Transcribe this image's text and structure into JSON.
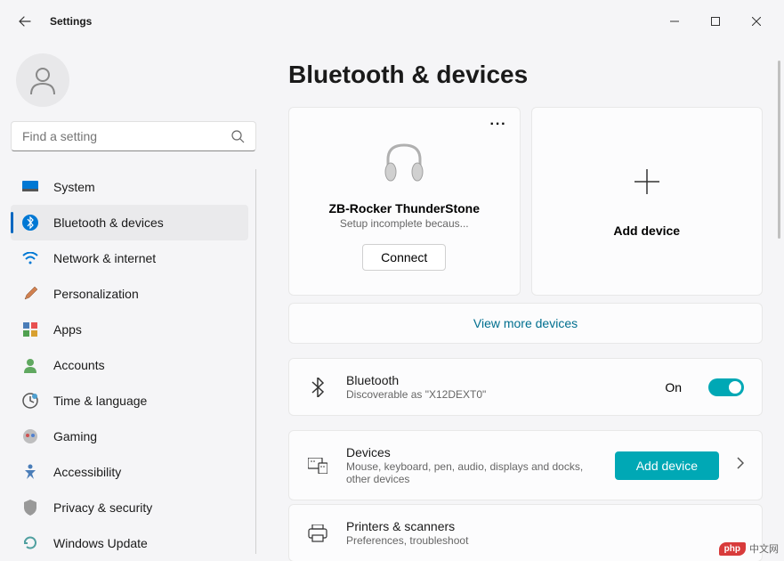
{
  "window": {
    "title": "Settings"
  },
  "search": {
    "placeholder": "Find a setting"
  },
  "sidebar": {
    "items": [
      {
        "label": "System",
        "icon": "system"
      },
      {
        "label": "Bluetooth & devices",
        "icon": "bluetooth",
        "active": true
      },
      {
        "label": "Network & internet",
        "icon": "wifi"
      },
      {
        "label": "Personalization",
        "icon": "brush"
      },
      {
        "label": "Apps",
        "icon": "apps"
      },
      {
        "label": "Accounts",
        "icon": "accounts"
      },
      {
        "label": "Time & language",
        "icon": "time"
      },
      {
        "label": "Gaming",
        "icon": "gaming"
      },
      {
        "label": "Accessibility",
        "icon": "accessibility"
      },
      {
        "label": "Privacy & security",
        "icon": "privacy"
      },
      {
        "label": "Windows Update",
        "icon": "update"
      }
    ]
  },
  "main": {
    "title": "Bluetooth & devices",
    "device_card": {
      "name": "ZB-Rocker ThunderStone",
      "status": "Setup incomplete becaus...",
      "connect_label": "Connect"
    },
    "add_device_card": {
      "label": "Add device"
    },
    "view_more": "View more devices",
    "bluetooth_row": {
      "title": "Bluetooth",
      "sub": "Discoverable as \"X12DEXT0\"",
      "toggle_label": "On",
      "toggle_on": true
    },
    "devices_row": {
      "title": "Devices",
      "sub": "Mouse, keyboard, pen, audio, displays and docks, other devices",
      "button_label": "Add device"
    },
    "printers_row": {
      "title": "Printers & scanners",
      "sub": "Preferences, troubleshoot"
    }
  },
  "watermark": {
    "badge": "php",
    "text": "中文网"
  }
}
